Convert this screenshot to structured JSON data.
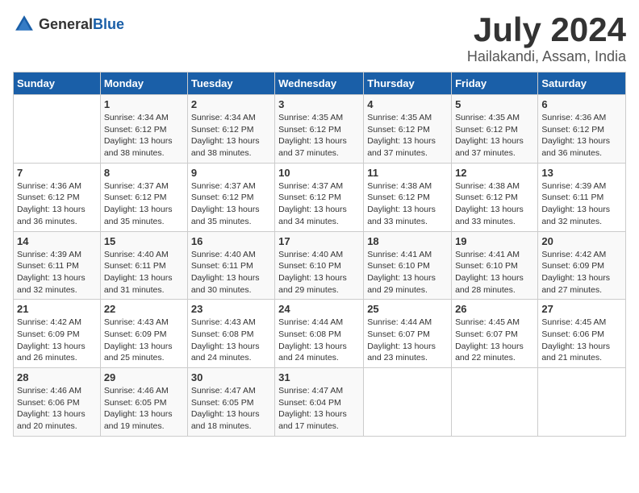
{
  "logo": {
    "text_general": "General",
    "text_blue": "Blue"
  },
  "title": "July 2024",
  "location": "Hailakandi, Assam, India",
  "days_header": [
    "Sunday",
    "Monday",
    "Tuesday",
    "Wednesday",
    "Thursday",
    "Friday",
    "Saturday"
  ],
  "weeks": [
    [
      {
        "day": "",
        "sunrise": "",
        "sunset": "",
        "daylight": ""
      },
      {
        "day": "1",
        "sunrise": "Sunrise: 4:34 AM",
        "sunset": "Sunset: 6:12 PM",
        "daylight": "Daylight: 13 hours and 38 minutes."
      },
      {
        "day": "2",
        "sunrise": "Sunrise: 4:34 AM",
        "sunset": "Sunset: 6:12 PM",
        "daylight": "Daylight: 13 hours and 38 minutes."
      },
      {
        "day": "3",
        "sunrise": "Sunrise: 4:35 AM",
        "sunset": "Sunset: 6:12 PM",
        "daylight": "Daylight: 13 hours and 37 minutes."
      },
      {
        "day": "4",
        "sunrise": "Sunrise: 4:35 AM",
        "sunset": "Sunset: 6:12 PM",
        "daylight": "Daylight: 13 hours and 37 minutes."
      },
      {
        "day": "5",
        "sunrise": "Sunrise: 4:35 AM",
        "sunset": "Sunset: 6:12 PM",
        "daylight": "Daylight: 13 hours and 37 minutes."
      },
      {
        "day": "6",
        "sunrise": "Sunrise: 4:36 AM",
        "sunset": "Sunset: 6:12 PM",
        "daylight": "Daylight: 13 hours and 36 minutes."
      }
    ],
    [
      {
        "day": "7",
        "sunrise": "Sunrise: 4:36 AM",
        "sunset": "Sunset: 6:12 PM",
        "daylight": "Daylight: 13 hours and 36 minutes."
      },
      {
        "day": "8",
        "sunrise": "Sunrise: 4:37 AM",
        "sunset": "Sunset: 6:12 PM",
        "daylight": "Daylight: 13 hours and 35 minutes."
      },
      {
        "day": "9",
        "sunrise": "Sunrise: 4:37 AM",
        "sunset": "Sunset: 6:12 PM",
        "daylight": "Daylight: 13 hours and 35 minutes."
      },
      {
        "day": "10",
        "sunrise": "Sunrise: 4:37 AM",
        "sunset": "Sunset: 6:12 PM",
        "daylight": "Daylight: 13 hours and 34 minutes."
      },
      {
        "day": "11",
        "sunrise": "Sunrise: 4:38 AM",
        "sunset": "Sunset: 6:12 PM",
        "daylight": "Daylight: 13 hours and 33 minutes."
      },
      {
        "day": "12",
        "sunrise": "Sunrise: 4:38 AM",
        "sunset": "Sunset: 6:12 PM",
        "daylight": "Daylight: 13 hours and 33 minutes."
      },
      {
        "day": "13",
        "sunrise": "Sunrise: 4:39 AM",
        "sunset": "Sunset: 6:11 PM",
        "daylight": "Daylight: 13 hours and 32 minutes."
      }
    ],
    [
      {
        "day": "14",
        "sunrise": "Sunrise: 4:39 AM",
        "sunset": "Sunset: 6:11 PM",
        "daylight": "Daylight: 13 hours and 32 minutes."
      },
      {
        "day": "15",
        "sunrise": "Sunrise: 4:40 AM",
        "sunset": "Sunset: 6:11 PM",
        "daylight": "Daylight: 13 hours and 31 minutes."
      },
      {
        "day": "16",
        "sunrise": "Sunrise: 4:40 AM",
        "sunset": "Sunset: 6:11 PM",
        "daylight": "Daylight: 13 hours and 30 minutes."
      },
      {
        "day": "17",
        "sunrise": "Sunrise: 4:40 AM",
        "sunset": "Sunset: 6:10 PM",
        "daylight": "Daylight: 13 hours and 29 minutes."
      },
      {
        "day": "18",
        "sunrise": "Sunrise: 4:41 AM",
        "sunset": "Sunset: 6:10 PM",
        "daylight": "Daylight: 13 hours and 29 minutes."
      },
      {
        "day": "19",
        "sunrise": "Sunrise: 4:41 AM",
        "sunset": "Sunset: 6:10 PM",
        "daylight": "Daylight: 13 hours and 28 minutes."
      },
      {
        "day": "20",
        "sunrise": "Sunrise: 4:42 AM",
        "sunset": "Sunset: 6:09 PM",
        "daylight": "Daylight: 13 hours and 27 minutes."
      }
    ],
    [
      {
        "day": "21",
        "sunrise": "Sunrise: 4:42 AM",
        "sunset": "Sunset: 6:09 PM",
        "daylight": "Daylight: 13 hours and 26 minutes."
      },
      {
        "day": "22",
        "sunrise": "Sunrise: 4:43 AM",
        "sunset": "Sunset: 6:09 PM",
        "daylight": "Daylight: 13 hours and 25 minutes."
      },
      {
        "day": "23",
        "sunrise": "Sunrise: 4:43 AM",
        "sunset": "Sunset: 6:08 PM",
        "daylight": "Daylight: 13 hours and 24 minutes."
      },
      {
        "day": "24",
        "sunrise": "Sunrise: 4:44 AM",
        "sunset": "Sunset: 6:08 PM",
        "daylight": "Daylight: 13 hours and 24 minutes."
      },
      {
        "day": "25",
        "sunrise": "Sunrise: 4:44 AM",
        "sunset": "Sunset: 6:07 PM",
        "daylight": "Daylight: 13 hours and 23 minutes."
      },
      {
        "day": "26",
        "sunrise": "Sunrise: 4:45 AM",
        "sunset": "Sunset: 6:07 PM",
        "daylight": "Daylight: 13 hours and 22 minutes."
      },
      {
        "day": "27",
        "sunrise": "Sunrise: 4:45 AM",
        "sunset": "Sunset: 6:06 PM",
        "daylight": "Daylight: 13 hours and 21 minutes."
      }
    ],
    [
      {
        "day": "28",
        "sunrise": "Sunrise: 4:46 AM",
        "sunset": "Sunset: 6:06 PM",
        "daylight": "Daylight: 13 hours and 20 minutes."
      },
      {
        "day": "29",
        "sunrise": "Sunrise: 4:46 AM",
        "sunset": "Sunset: 6:05 PM",
        "daylight": "Daylight: 13 hours and 19 minutes."
      },
      {
        "day": "30",
        "sunrise": "Sunrise: 4:47 AM",
        "sunset": "Sunset: 6:05 PM",
        "daylight": "Daylight: 13 hours and 18 minutes."
      },
      {
        "day": "31",
        "sunrise": "Sunrise: 4:47 AM",
        "sunset": "Sunset: 6:04 PM",
        "daylight": "Daylight: 13 hours and 17 minutes."
      },
      {
        "day": "",
        "sunrise": "",
        "sunset": "",
        "daylight": ""
      },
      {
        "day": "",
        "sunrise": "",
        "sunset": "",
        "daylight": ""
      },
      {
        "day": "",
        "sunrise": "",
        "sunset": "",
        "daylight": ""
      }
    ]
  ]
}
